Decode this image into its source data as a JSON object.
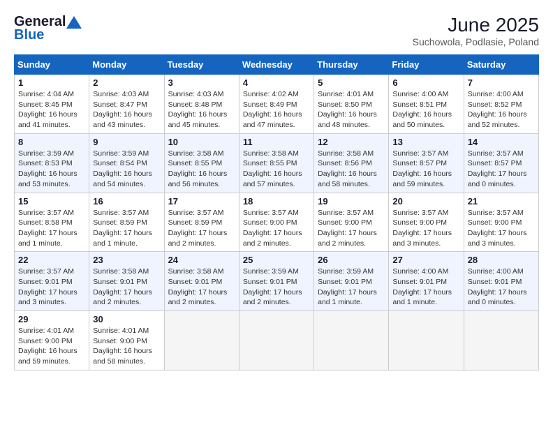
{
  "logo": {
    "general": "General",
    "blue": "Blue"
  },
  "title": "June 2025",
  "location": "Suchowola, Podlasie, Poland",
  "days_header": [
    "Sunday",
    "Monday",
    "Tuesday",
    "Wednesday",
    "Thursday",
    "Friday",
    "Saturday"
  ],
  "weeks": [
    [
      {
        "day": "1",
        "info": "Sunrise: 4:04 AM\nSunset: 8:45 PM\nDaylight: 16 hours\nand 41 minutes."
      },
      {
        "day": "2",
        "info": "Sunrise: 4:03 AM\nSunset: 8:47 PM\nDaylight: 16 hours\nand 43 minutes."
      },
      {
        "day": "3",
        "info": "Sunrise: 4:03 AM\nSunset: 8:48 PM\nDaylight: 16 hours\nand 45 minutes."
      },
      {
        "day": "4",
        "info": "Sunrise: 4:02 AM\nSunset: 8:49 PM\nDaylight: 16 hours\nand 47 minutes."
      },
      {
        "day": "5",
        "info": "Sunrise: 4:01 AM\nSunset: 8:50 PM\nDaylight: 16 hours\nand 48 minutes."
      },
      {
        "day": "6",
        "info": "Sunrise: 4:00 AM\nSunset: 8:51 PM\nDaylight: 16 hours\nand 50 minutes."
      },
      {
        "day": "7",
        "info": "Sunrise: 4:00 AM\nSunset: 8:52 PM\nDaylight: 16 hours\nand 52 minutes."
      }
    ],
    [
      {
        "day": "8",
        "info": "Sunrise: 3:59 AM\nSunset: 8:53 PM\nDaylight: 16 hours\nand 53 minutes."
      },
      {
        "day": "9",
        "info": "Sunrise: 3:59 AM\nSunset: 8:54 PM\nDaylight: 16 hours\nand 54 minutes."
      },
      {
        "day": "10",
        "info": "Sunrise: 3:58 AM\nSunset: 8:55 PM\nDaylight: 16 hours\nand 56 minutes."
      },
      {
        "day": "11",
        "info": "Sunrise: 3:58 AM\nSunset: 8:55 PM\nDaylight: 16 hours\nand 57 minutes."
      },
      {
        "day": "12",
        "info": "Sunrise: 3:58 AM\nSunset: 8:56 PM\nDaylight: 16 hours\nand 58 minutes."
      },
      {
        "day": "13",
        "info": "Sunrise: 3:57 AM\nSunset: 8:57 PM\nDaylight: 16 hours\nand 59 minutes."
      },
      {
        "day": "14",
        "info": "Sunrise: 3:57 AM\nSunset: 8:57 PM\nDaylight: 17 hours\nand 0 minutes."
      }
    ],
    [
      {
        "day": "15",
        "info": "Sunrise: 3:57 AM\nSunset: 8:58 PM\nDaylight: 17 hours\nand 1 minute."
      },
      {
        "day": "16",
        "info": "Sunrise: 3:57 AM\nSunset: 8:59 PM\nDaylight: 17 hours\nand 1 minute."
      },
      {
        "day": "17",
        "info": "Sunrise: 3:57 AM\nSunset: 8:59 PM\nDaylight: 17 hours\nand 2 minutes."
      },
      {
        "day": "18",
        "info": "Sunrise: 3:57 AM\nSunset: 9:00 PM\nDaylight: 17 hours\nand 2 minutes."
      },
      {
        "day": "19",
        "info": "Sunrise: 3:57 AM\nSunset: 9:00 PM\nDaylight: 17 hours\nand 2 minutes."
      },
      {
        "day": "20",
        "info": "Sunrise: 3:57 AM\nSunset: 9:00 PM\nDaylight: 17 hours\nand 3 minutes."
      },
      {
        "day": "21",
        "info": "Sunrise: 3:57 AM\nSunset: 9:00 PM\nDaylight: 17 hours\nand 3 minutes."
      }
    ],
    [
      {
        "day": "22",
        "info": "Sunrise: 3:57 AM\nSunset: 9:01 PM\nDaylight: 17 hours\nand 3 minutes."
      },
      {
        "day": "23",
        "info": "Sunrise: 3:58 AM\nSunset: 9:01 PM\nDaylight: 17 hours\nand 2 minutes."
      },
      {
        "day": "24",
        "info": "Sunrise: 3:58 AM\nSunset: 9:01 PM\nDaylight: 17 hours\nand 2 minutes."
      },
      {
        "day": "25",
        "info": "Sunrise: 3:59 AM\nSunset: 9:01 PM\nDaylight: 17 hours\nand 2 minutes."
      },
      {
        "day": "26",
        "info": "Sunrise: 3:59 AM\nSunset: 9:01 PM\nDaylight: 17 hours\nand 1 minute."
      },
      {
        "day": "27",
        "info": "Sunrise: 4:00 AM\nSunset: 9:01 PM\nDaylight: 17 hours\nand 1 minute."
      },
      {
        "day": "28",
        "info": "Sunrise: 4:00 AM\nSunset: 9:01 PM\nDaylight: 17 hours\nand 0 minutes."
      }
    ],
    [
      {
        "day": "29",
        "info": "Sunrise: 4:01 AM\nSunset: 9:00 PM\nDaylight: 16 hours\nand 59 minutes."
      },
      {
        "day": "30",
        "info": "Sunrise: 4:01 AM\nSunset: 9:00 PM\nDaylight: 16 hours\nand 58 minutes."
      },
      {
        "day": "",
        "info": ""
      },
      {
        "day": "",
        "info": ""
      },
      {
        "day": "",
        "info": ""
      },
      {
        "day": "",
        "info": ""
      },
      {
        "day": "",
        "info": ""
      }
    ]
  ]
}
